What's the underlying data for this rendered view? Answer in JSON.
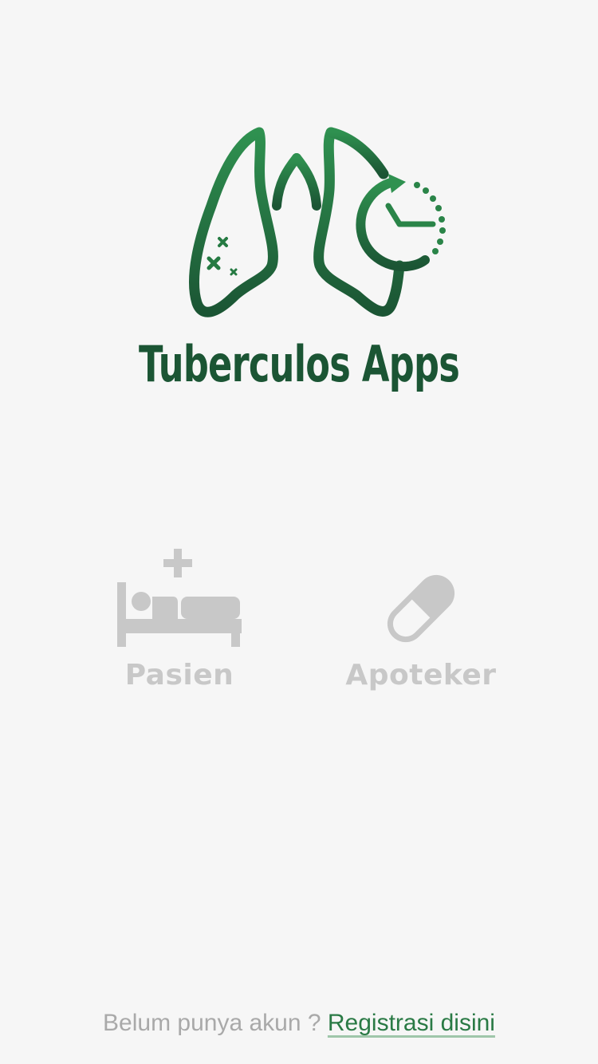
{
  "app": {
    "title": "Tuberculos Apps",
    "brand_color_light": "#2f9150",
    "brand_color_dark": "#1b5534"
  },
  "roles": [
    {
      "label": "Pasien",
      "icon": "hospital-bed-icon"
    },
    {
      "label": "Apoteker",
      "icon": "pill-capsule-icon"
    }
  ],
  "footer": {
    "prompt": "Belum punya akun ? ",
    "register_link": "Registrasi disini"
  },
  "colors": {
    "background": "#f6f6f6",
    "icon_gray": "#c8c8c8",
    "footer_text": "#a9a9a9",
    "link": "#2a7a45"
  }
}
